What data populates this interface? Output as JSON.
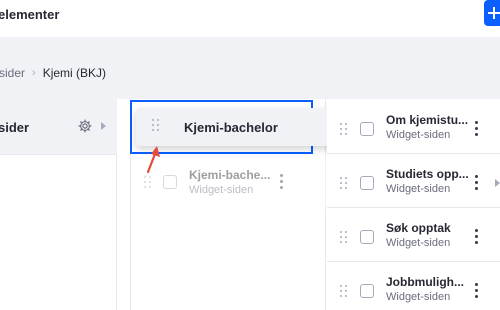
{
  "header": {
    "title": "elementer",
    "add_label": "+"
  },
  "breadcrumb": {
    "parent": "sider",
    "separator": "›",
    "current": "Kjemi (BKJ)"
  },
  "column1": {
    "row_label": "sider"
  },
  "column2": {
    "dragging": {
      "title": "Kjemi-bachelor"
    },
    "ghost": {
      "title": "Kjemi-bache...",
      "subtitle": "Widget-siden"
    }
  },
  "column3": {
    "items": [
      {
        "title": "Om kjemistu...",
        "subtitle": "Widget-siden",
        "has_children": false
      },
      {
        "title": "Studiets opp...",
        "subtitle": "Widget-siden",
        "has_children": true
      },
      {
        "title": "Søk opptak",
        "subtitle": "Widget-siden",
        "has_children": false
      },
      {
        "title": "Jobbmuligh...",
        "subtitle": "Widget-siden",
        "has_children": false
      }
    ]
  },
  "colors": {
    "primary": "#0b5fff",
    "annotation_arrow": "#e5493a",
    "secondary_bg": "#f1f2f5"
  },
  "icons": [
    "plus-icon",
    "chevron-right-icon",
    "gear-icon",
    "drag-handle-icon",
    "kebab-menu-icon",
    "annotation-arrow-icon"
  ]
}
